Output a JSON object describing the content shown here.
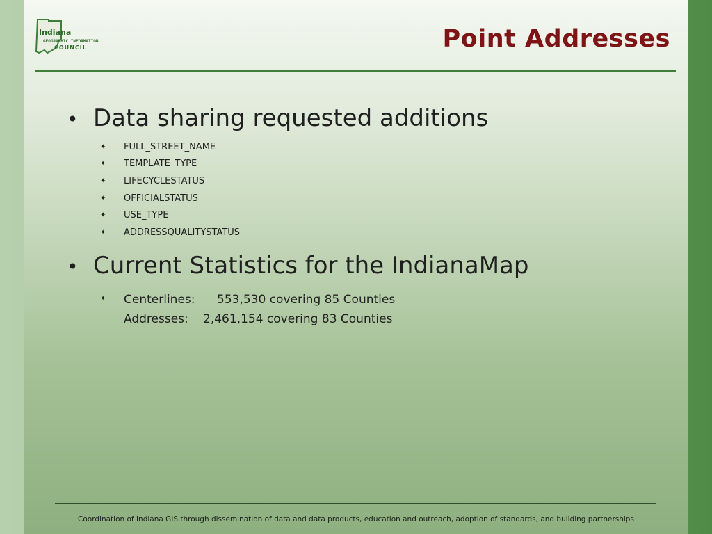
{
  "header": {
    "title": "Point Addresses",
    "logo": {
      "line1": "Indiana",
      "line2": "GEOGRAPHIC INFORMATION",
      "line3": "COUNCIL"
    }
  },
  "bullets": [
    {
      "text": "Data sharing requested additions",
      "subitems": [
        "FULL_STREET_NAME",
        "TEMPLATE_TYPE",
        "LIFECYCLESTATUS",
        "OFFICIALSTATUS",
        "USE_TYPE",
        "ADDRESSQUALITYSTATUS"
      ]
    },
    {
      "text": "Current Statistics for the IndianaMap",
      "stats": [
        {
          "label": "Centerlines:",
          "value": "553,530 covering 85 Counties"
        },
        {
          "label": "Addresses:",
          "value": "2,461,154 covering 83 Counties"
        }
      ]
    }
  ],
  "footer": {
    "text": "Coordination of Indiana GIS through dissemination of data and data products, education and outreach, adoption of standards, and building partnerships"
  },
  "colors": {
    "title": "#7f1416",
    "accent_rule": "#3f7d3b",
    "side_band": "#4f8a47"
  }
}
